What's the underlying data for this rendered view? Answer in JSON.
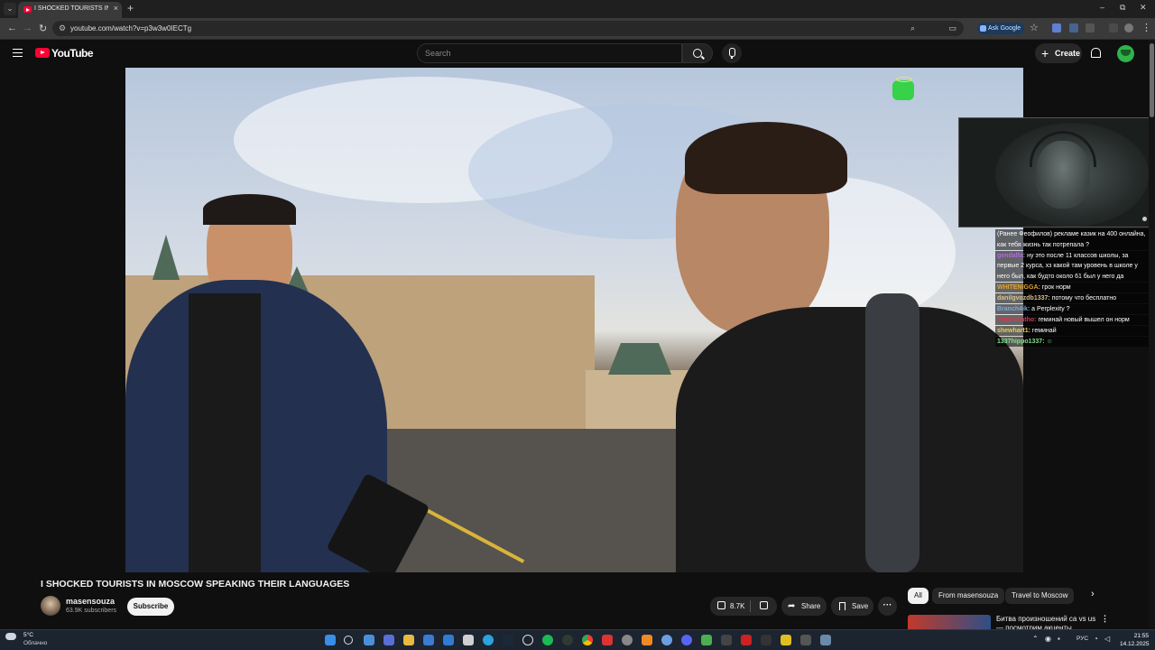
{
  "browser": {
    "tab_title": "I SHOCKED TOURISTS IN MOSC",
    "url": "youtube.com/watch?v=p3w3w0IECTg",
    "ask_google": "Ask Google",
    "new_tab": "+",
    "tab_close": "×",
    "win_minimize": "–",
    "win_restore": "⧉",
    "win_close": "✕"
  },
  "youtube": {
    "logo_text": "YouTube",
    "search_placeholder": "Search",
    "create_label": "Create"
  },
  "chat": [
    {
      "nick": "",
      "text": "(Ранее Феофилов) рекламе казик на 400 онлайна, как тебя жизнь так потрепала ?",
      "color": "#ffffff"
    },
    {
      "nick": "gendalfa:",
      "text": "ну это после 11 классов школы, за первые 2 курса, хз какой там уровень в школе у него был, как будто около 61 был у него да",
      "color": "#b36ad6"
    },
    {
      "nick": "WHITENIGGA:",
      "text": "грок норм",
      "color": "#e3a12b"
    },
    {
      "nick": "danilgvozdb1337:",
      "text": "потому что бесплатно",
      "color": "#d8c08c"
    },
    {
      "nick": "Branch4ik:",
      "text": "а Perplexity ?",
      "color": "#7fa7e0"
    },
    {
      "nick": "PrнsetSatho:",
      "text": "геминай новый вышел он норм",
      "color": "#d03a5a"
    },
    {
      "nick": "shewhart1:",
      "text": "геминай",
      "color": "#e6cf4a"
    },
    {
      "nick": "1337hippo1337:",
      "text": "☺",
      "color": "#7ee08a"
    }
  ],
  "video": {
    "title": "I SHOCKED TOURISTS IN MOSCOW SPEAKING THEIR LANGUAGES",
    "channel_name": "masensouza",
    "subscribers": "63.9K subscribers",
    "subscribe_label": "Subscribe",
    "likes": "8.7K",
    "share_label": "Share",
    "save_label": "Save",
    "more_label": "···"
  },
  "chips": [
    {
      "label": "All",
      "active": true
    },
    {
      "label": "From masensouza",
      "active": false
    },
    {
      "label": "Travel to Moscow",
      "active": false
    }
  ],
  "recommendation": {
    "title": "Битва произношений ca vs us — посмотрим акценты"
  },
  "taskbar": {
    "temperature": "5°C",
    "weather_text": "Облачно",
    "language": "РУС",
    "time": "21:55",
    "date": "14.12.2025"
  }
}
